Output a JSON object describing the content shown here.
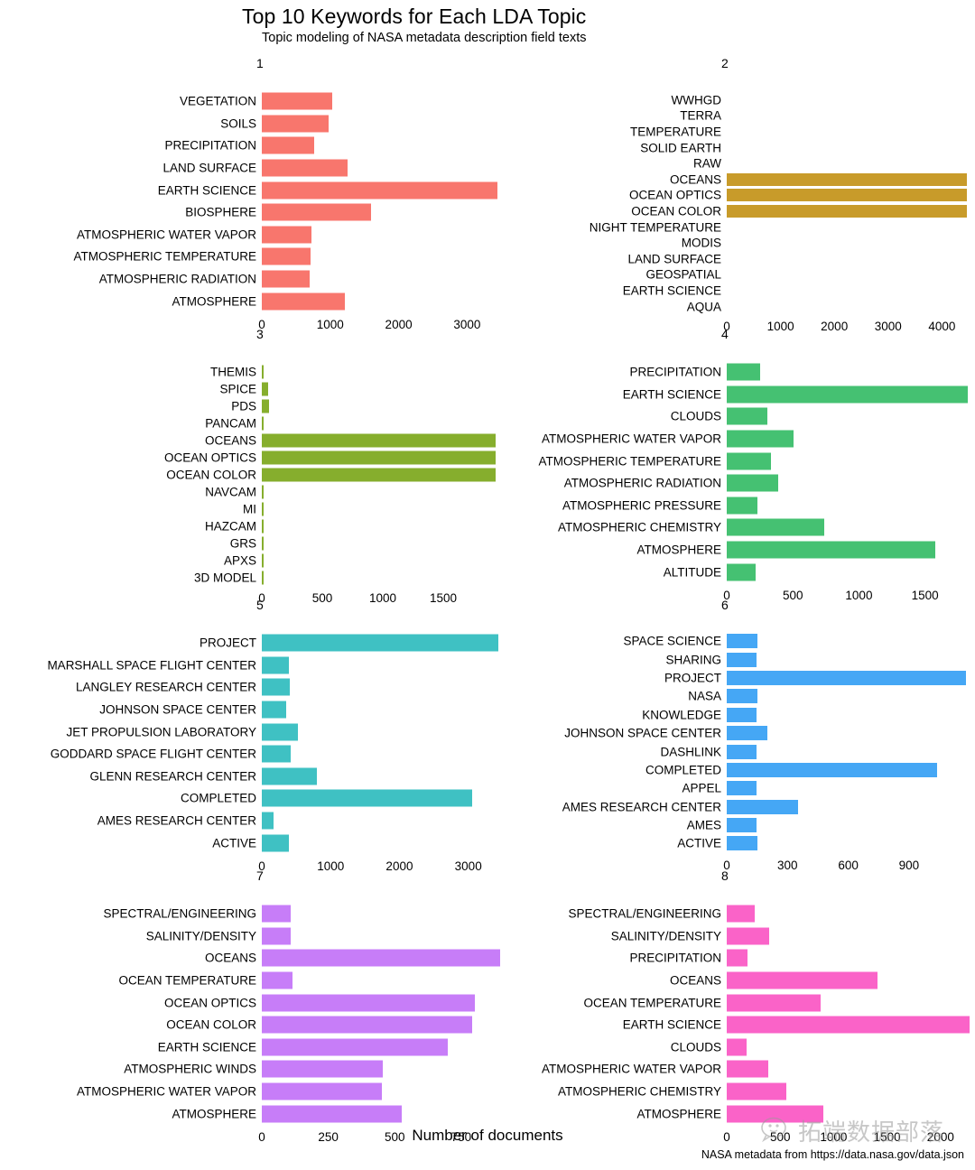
{
  "header": {
    "title": "Top 10 Keywords for Each LDA Topic",
    "subtitle": "Topic modeling of NASA metadata description field texts"
  },
  "footer": {
    "axis_title": "Number of documents",
    "caption": "NASA metadata from https://data.nasa.gov/data.json"
  },
  "watermark": {
    "text": "拓端数据部落",
    "icon": "wechat-icon"
  },
  "chart_data": {
    "type": "bar",
    "title": "Top 10 Keywords for Each LDA Topic",
    "subtitle": "Topic modeling of NASA metadata description field texts",
    "xlabel": "Number of documents",
    "ylabel": "",
    "orientation": "horizontal",
    "grid": false,
    "legend": false,
    "facet_layout": "2 columns x 4 rows, free scales",
    "panels": [
      {
        "id": "1",
        "color": "#F8766D",
        "xlim": [
          0,
          3470
        ],
        "xticks": [
          0,
          1000,
          2000,
          3000
        ],
        "categories": [
          "VEGETATION",
          "SOILS",
          "PRECIPITATION",
          "LAND SURFACE",
          "EARTH SCIENCE",
          "BIOSPHERE",
          "ATMOSPHERIC WATER VAPOR",
          "ATMOSPHERIC TEMPERATURE",
          "ATMOSPHERIC RADIATION",
          "ATMOSPHERE"
        ],
        "values": [
          1030,
          980,
          760,
          1250,
          3440,
          1590,
          720,
          710,
          700,
          1210
        ]
      },
      {
        "id": "2",
        "color": "#C89B2A",
        "xlim": [
          0,
          4480
        ],
        "xticks": [
          0,
          1000,
          2000,
          3000,
          4000
        ],
        "categories": [
          "WWHGD",
          "TERRA",
          "TEMPERATURE",
          "SOLID EARTH",
          "RAW",
          "OCEANS",
          "OCEAN OPTICS",
          "OCEAN COLOR",
          "NIGHT TEMPERATURE",
          "MODIS",
          "LAND SURFACE",
          "GEOSPATIAL",
          "EARTH SCIENCE",
          "AQUA"
        ],
        "values": [
          0,
          0,
          0,
          0,
          0,
          4470,
          4470,
          4470,
          0,
          0,
          0,
          0,
          0,
          0
        ]
      },
      {
        "id": "3",
        "color": "#86AE2D",
        "xlim": [
          0,
          1940
        ],
        "xticks": [
          0,
          500,
          1000,
          1500
        ],
        "categories": [
          "THEMIS",
          "SPICE",
          "PDS",
          "PANCAM",
          "OCEANS",
          "OCEAN OPTICS",
          "OCEAN COLOR",
          "NAVCAM",
          "MI",
          "HAZCAM",
          "GRS",
          "APXS",
          "3D MODEL"
        ],
        "values": [
          12,
          55,
          58,
          14,
          1930,
          1930,
          1930,
          18,
          14,
          16,
          14,
          14,
          16
        ]
      },
      {
        "id": "4",
        "color": "#45C172",
        "xlim": [
          0,
          1830
        ],
        "xticks": [
          0,
          500,
          1000,
          1500
        ],
        "categories": [
          "PRECIPITATION",
          "EARTH SCIENCE",
          "CLOUDS",
          "ATMOSPHERIC WATER VAPOR",
          "ATMOSPHERIC TEMPERATURE",
          "ATMOSPHERIC RADIATION",
          "ATMOSPHERIC PRESSURE",
          "ATMOSPHERIC CHEMISTRY",
          "ATMOSPHERE",
          "ALTITUDE"
        ],
        "values": [
          255,
          1820,
          310,
          505,
          335,
          390,
          235,
          735,
          1580,
          220
        ]
      },
      {
        "id": "5",
        "color": "#3FC1C3",
        "xlim": [
          0,
          3450
        ],
        "xticks": [
          0,
          1000,
          2000,
          3000
        ],
        "categories": [
          "PROJECT",
          "MARSHALL SPACE FLIGHT CENTER",
          "LANGLEY RESEARCH CENTER",
          "JOHNSON SPACE CENTER",
          "JET PROPULSION LABORATORY",
          "GODDARD SPACE FLIGHT CENTER",
          "GLENN RESEARCH CENTER",
          "COMPLETED",
          "AMES RESEARCH CENTER",
          "ACTIVE"
        ],
        "values": [
          3440,
          400,
          410,
          360,
          530,
          425,
          800,
          3060,
          175,
          400
        ]
      },
      {
        "id": "6",
        "color": "#45A7F5",
        "xlim": [
          0,
          1190
        ],
        "xticks": [
          0,
          300,
          600,
          900
        ],
        "categories": [
          "SPACE SCIENCE",
          "SHARING",
          "PROJECT",
          "NASA",
          "KNOWLEDGE",
          "JOHNSON SPACE CENTER",
          "DASHLINK",
          "COMPLETED",
          "APPEL",
          "AMES RESEARCH CENTER",
          "AMES",
          "ACTIVE"
        ],
        "values": [
          150,
          148,
          1180,
          150,
          148,
          200,
          148,
          1040,
          148,
          350,
          148,
          150
        ]
      },
      {
        "id": "7",
        "color": "#C77DF8",
        "xlim": [
          0,
          900
        ],
        "xticks": [
          0,
          250,
          500,
          750
        ],
        "categories": [
          "SPECTRAL/ENGINEERING",
          "SALINITY/DENSITY",
          "OCEANS",
          "OCEAN TEMPERATURE",
          "OCEAN OPTICS",
          "OCEAN COLOR",
          "EARTH SCIENCE",
          "ATMOSPHERIC WINDS",
          "ATMOSPHERIC WATER VAPOR",
          "ATMOSPHERE"
        ],
        "values": [
          110,
          108,
          895,
          115,
          800,
          790,
          700,
          455,
          450,
          525
        ]
      },
      {
        "id": "8",
        "color": "#FA63C8",
        "xlim": [
          0,
          2280
        ],
        "xticks": [
          0,
          500,
          1000,
          1500,
          2000
        ],
        "categories": [
          "SPECTRAL/ENGINEERING",
          "SALINITY/DENSITY",
          "PRECIPITATION",
          "OCEANS",
          "OCEAN TEMPERATURE",
          "EARTH SCIENCE",
          "CLOUDS",
          "ATMOSPHERIC WATER VAPOR",
          "ATMOSPHERIC CHEMISTRY",
          "ATMOSPHERE"
        ],
        "values": [
          265,
          400,
          190,
          1410,
          880,
          2270,
          185,
          390,
          560,
          900
        ]
      }
    ]
  }
}
